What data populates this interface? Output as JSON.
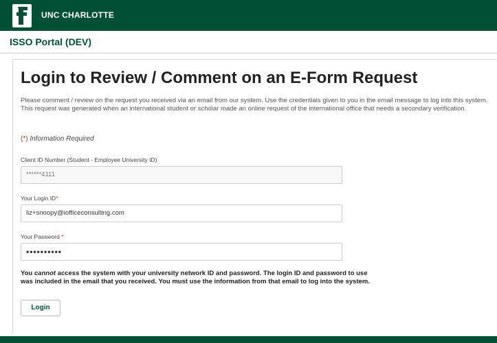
{
  "header": {
    "logo_icon": "unc-charlotte-logo-icon",
    "brand": "UNC CHARLOTTE",
    "subtitle": "ISSO Portal (DEV)"
  },
  "main": {
    "title": "Login to Review / Comment on an E-Form Request",
    "intro": "Please comment / review on the request you received via an email from our system. Use the credentials given to you in the email message to log into this system. This request was generated when an international student or scholar made an online request of the international office that needs a secondary verification.",
    "required_marker": "(*)",
    "required_text": " Information Required",
    "client_id": {
      "label": "Client ID Number (Student - Employee University ID)",
      "value": "******4111"
    },
    "login_id": {
      "label": "Your Login ID",
      "required": "*",
      "value": "liz+snoopy@iofficeconsulting.com"
    },
    "password": {
      "label": "Your Password ",
      "required": "*",
      "value": "••••••••••"
    },
    "warning_pre": "You ",
    "warning_em": "cannot",
    "warning_post": " access the system with your university network ID and password. The login ID and password to use was included in the email that you received. You must use the information from that email to log into the system.",
    "login_button": "Login"
  },
  "colors": {
    "brand_green": "#005035",
    "required_red": "#c0392b"
  }
}
